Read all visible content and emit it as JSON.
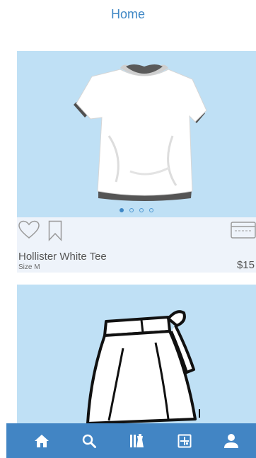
{
  "header": {
    "title": "Home"
  },
  "feed": {
    "items": [
      {
        "title": "Hollister White Tee",
        "size": "Size M",
        "price": "$15",
        "image_icon": "white-tshirt-illustration",
        "carousel": {
          "count": 4,
          "active_index": 0
        }
      },
      {
        "image_icon": "skirt-illustration"
      }
    ]
  },
  "tabbar": {
    "tabs": [
      "home-icon",
      "search-icon",
      "closet-icon",
      "store-icon",
      "profile-icon"
    ],
    "active": "home"
  },
  "colors": {
    "accent": "#4285c4",
    "title": "#3f87c5",
    "image_background": "#bfe0f5",
    "card_background": "#eef3fa"
  }
}
